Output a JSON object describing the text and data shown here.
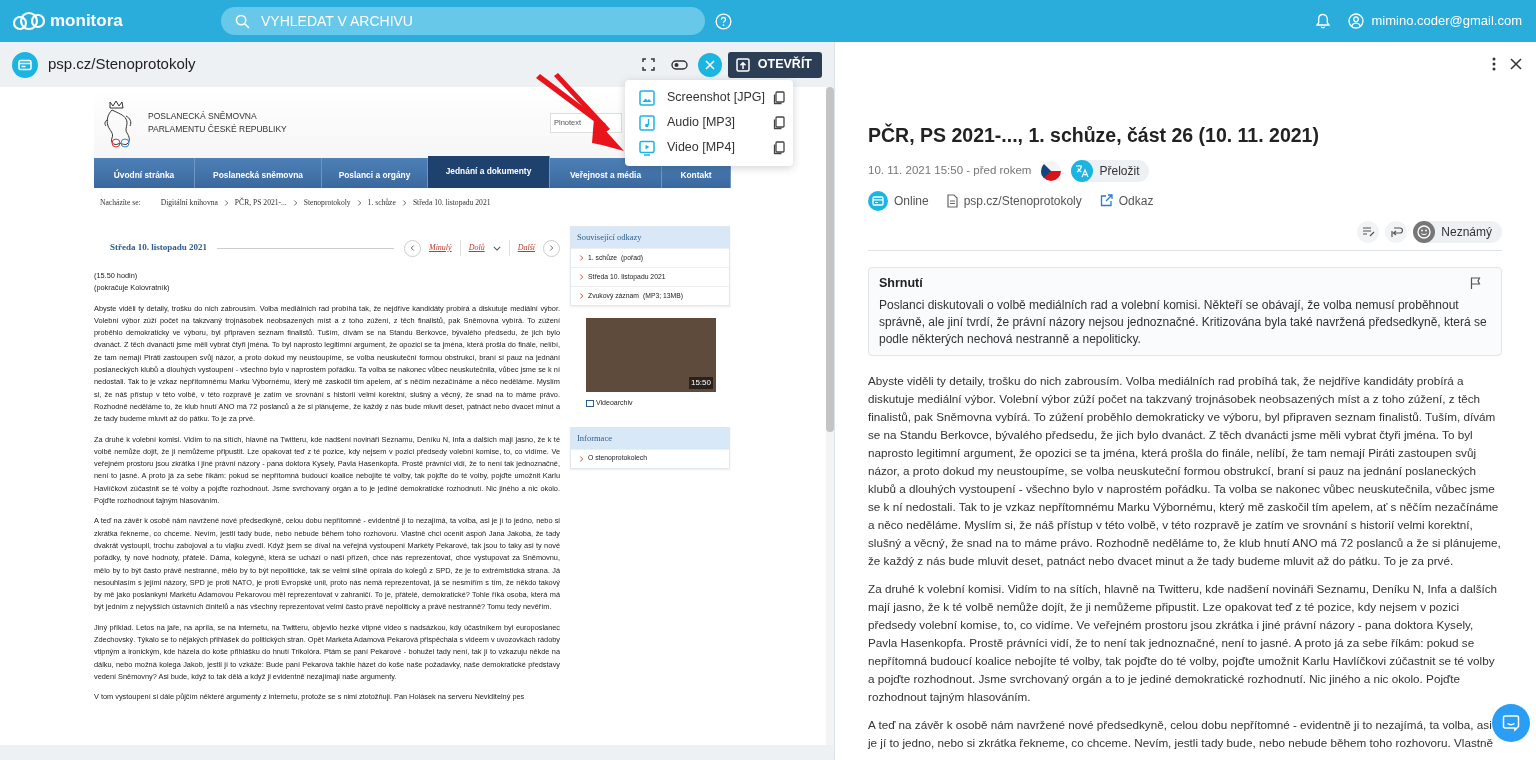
{
  "app_bar": {
    "logo": "monitora",
    "search_placeholder": "VYHLEDAT V ARCHIVU",
    "user": "mimino.coder@gmail.com"
  },
  "viewer": {
    "source": "psp.cz/Stenoprotokoly",
    "open_button": "OTEVŘÍT",
    "menu": [
      {
        "label": "Screenshot [JPG]",
        "kind": "image"
      },
      {
        "label": "Audio [MP3]",
        "kind": "audio"
      },
      {
        "label": "Video [MP4]",
        "kind": "video"
      }
    ]
  },
  "page": {
    "org_lines": [
      "POSLANECKÁ SNĚMOVNA",
      "PARLAMENTU ČESKÉ REPUBLIKY"
    ],
    "search_placeholder": "Plnotext",
    "nav": [
      {
        "label": "Úvodní stránka",
        "selected": false
      },
      {
        "label": "Poslanecká sněmovna",
        "selected": false
      },
      {
        "label": "Poslanci a orgány",
        "selected": false
      },
      {
        "label": "Jednání a dokumenty",
        "selected": true
      },
      {
        "label": "Veřejnost a média",
        "selected": false
      },
      {
        "label": "Kontakt",
        "selected": false
      }
    ],
    "breadcrumb_label": "Nacházíte se:",
    "breadcrumb": [
      "Digitální knihovna",
      "PČR, PS 2021-...",
      "Stenoprotokoly",
      "1. schůze",
      "Středa 10. listopadu 2021"
    ],
    "date_heading": "Středa 10. listopadu 2021",
    "pager": {
      "prev": "Minulý",
      "down": "Dolů",
      "next": "Další"
    },
    "intro_lines": [
      "(15.50 hodin)",
      "(pokračuje Kolovratník)"
    ],
    "paragraphs": [
      "Abyste viděli ty detaily, trošku do nich zabrousím. Volba mediálních rad probíhá tak, že nejdříve kandidáty probírá a diskutuje mediální výbor. Volební výbor zúží počet na takzvaný trojnásobek neobsazených míst a z toho zúžení, z těch finalistů, pak Sněmovna vybírá. To zúžení proběhlo demokraticky ve výboru, byl připraven seznam finalistů. Tuším, dívám se na Standu Berkovce, bývalého předsedu, že jich bylo dvanáct. Z těch dvanácti jsme měli vybrat čtyři jména. To byl naprosto legitimní argument, že opozici se ta jména, která prošla do finále, nelíbí, že tam nemají Piráti zastoupen svůj názor, a proto dokud my neustoupíme, se volba neuskuteční formou obstrukcí, braní si pauz na jednání poslaneckých klubů a dlouhých vystoupení - všechno bylo v naprostém pořádku. Ta volba se nakonec vůbec neuskutečnila, vůbec jsme se k ní nedostali. Tak to je vzkaz nepřítomnému Marku Výbornému, který mě zaskočil tím apelem, ať s něčím nezačínáme a něco neděláme. Myslím si, že náš přístup v této volbě, v této rozpravě je zatím ve srovnání s historií velmi korektní, slušný a věcný, že snad na to máme právo. Rozhodně neděláme to, že klub hnutí ANO má 72 poslanců a že si plánujeme, že každý z nás bude mluvit deset, patnáct nebo dvacet minut a že tady budeme mluvit až do pátku. To je za prvé.",
      "Za druhé k volební komisi. Vidím to na sítích, hlavně na Twitteru, kde nadšení novináři Seznamu, Deníku N, Infa a dalších mají jasno, že k té volbě nemůže dojít, že ji nemůžeme připustit. Lze opakovat teď z té pozice, kdy nejsem v pozici předsedy volební komise, to, co vidíme. Ve veřejném prostoru jsou zkrátka i jiné právní názory - pana doktora Kysely, Pavla Hasenkopfa. Prostě právníci vidí, že to není tak jednoznačné, není to jasné. A proto já za sebe říkám: pokud se nepřítomná budoucí koalice nebojíte té volby, tak pojďte do té volby, pojďte umožnit Karlu Havlíčkovi zúčastnit se té volby a pojďte rozhodnout. Jsme svrchovaný orgán a to je jediné demokratické rozhodnutí. Nic jiného a nic okolo. Pojďte rozhodnout tajným hlasováním.",
      "A teď na závěr k osobě nám navržené nové předsedkyně, celou dobu nepřítomné - evidentně ji to nezajímá, ta volba, asi je jí to jedno, nebo si zkrátka řekneme, co chceme. Nevím, jestli tady bude, nebo nebude během toho rozhovoru. Vlastně chci ocenit aspoň Jana Jakoba, že tady dvakrát vystoupil, trochu zabojoval a tu vlajku zvedl. Když jsem se díval na veřejná vystoupení Markéty Pekarové, tak jsou to taky asi ty nové pořádky, ty nové hodnoty, přátelé. Dáma, kolegyně, která se uchází o naši přízeň, chce nás reprezentovat, chce vystupovat za Sněmovnu, mělo by to být často právě nestranné, mělo by to být nepolitické, tak se velmi silně opírala do kolegů z SPD, že je to extrémistická strana. Já nesouhlasím s jejími názory, SPD je proti NATO, je proti Evropské unii, proto nás nemá reprezentovat, já se nesmířím s tím, že někdo takový by mě jako poslankyni Markétu Adamovou Pekarovou měl reprezentovat v zahraničí. To je, přátelé, demokratické? Tohle říká osoba, která má být jedním z nejvyšších ústavních činitelů a nás všechny reprezentovat velmi často právě nepoliticky a právě nestranně? Tomu tedy nevěřím.",
      "Jiný příklad. Letos na jaře, na apríla, se na internetu, na Twitteru, objevilo hezké vtipné video s nadsázkou, kdy účastníkem byl europoslanec Zdechovský. Týkalo se to nějakých přihlášek do politických stran. Opět Markéta Adamová Pekarová přispěchala s videem v uvozovkách rádoby vtipným a ironickým, kde házela do koše přihlášku do hnutí Trikolóra. Ptám se paní Pekarové - bohužel tady není, tak jí to vzkazuju někde na dálku, nebo možná kolega Jakob, jestli jí to vzkáže: Bude paní Pekarová takhle házet do koše naše požadavky, naše demokratické představy vedení Sněmovny? Asi bude, když to tak dělá a když ji evidentně nezajímají naše argumenty.",
      "V tom vystoupení si dále půjčím některé argumenty z internetu, protože se s nimi ztotožňuji. Pan Holásek na serveru Neviditelný pes"
    ],
    "related": {
      "title": "Související odkazy",
      "items": [
        {
          "link": "1. schůze",
          "note": "(pořad)"
        },
        {
          "link": "Středa 10. listopadu 2021"
        },
        {
          "link": "Zvukový záznam",
          "note": "(MP3; 13MB)"
        }
      ]
    },
    "video": {
      "time": "15:50",
      "link": "Videoarchiv"
    },
    "info": {
      "title": "Informace",
      "items": [
        {
          "link": "O stenoprotokolech"
        }
      ]
    }
  },
  "article": {
    "title": "PČR, PS 2021-..., 1. schůze, část 26 (10. 11. 2021)",
    "date": "10. 11. 2021 15:50 - před rokem",
    "translate": "Přeložit",
    "medium": "Online",
    "source": "psp.cz/Stenoprotokoly",
    "link": "Odkaz",
    "sentiment": "Neznámý",
    "summary": {
      "title": "Shrnutí",
      "text": "Poslanci diskutovali o volbě mediálních rad a volební komisi. Někteří se obávají, že volba nemusí proběhnout správně, ale jiní tvrdí, že právní názory nejsou jednoznačné. Kritizována byla také navržená předsedkyně, která se podle některých nechová nestranně a nepoliticky."
    },
    "paragraphs": [
      "Abyste viděli ty detaily, trošku do nich zabrousím. Volba mediálních rad probíhá tak, že nejdříve kandidáty probírá a diskutuje mediální výbor. Volební výbor zúží počet na takzvaný trojnásobek neobsazených míst a z toho zúžení, z těch finalistů, pak Sněmovna vybírá. To zúžení proběhlo demokraticky ve výboru, byl připraven seznam finalistů. Tuším, dívám se na Standu Berkovce, bývalého předsedu, že jich bylo dvanáct. Z těch dvanácti jsme měli vybrat čtyři jména. To byl naprosto legitimní argument, že opozici se ta jména, která prošla do finále, nelíbí, že tam nemají Piráti zastoupen svůj názor, a proto dokud my neustoupíme, se volba neuskuteční formou obstrukcí, braní si pauz na jednání poslaneckých klubů a dlouhých vystoupení - všechno bylo v naprostém pořádku. Ta volba se nakonec vůbec neuskutečnila, vůbec jsme se k ní nedostali. Tak to je vzkaz nepřítomnému Marku Výbornému, který mě zaskočil tím apelem, ať s něčím nezačínáme a něco neděláme. Myslím si, že náš přístup v této volbě, v této rozpravě je zatím ve srovnání s historií velmi korektní, slušný a věcný, že snad na to máme právo. Rozhodně neděláme to, že klub hnutí ANO má 72 poslanců a že si plánujeme, že každý z nás bude mluvit deset, patnáct nebo dvacet minut a že tady budeme mluvit až do pátku. To je za prvé.",
      "Za druhé k volební komisi. Vidím to na sítích, hlavně na Twitteru, kde nadšení novináři Seznamu, Deníku N, Infa a dalších mají jasno, že k té volbě nemůže dojít, že ji nemůžeme připustit. Lze opakovat teď z té pozice, kdy nejsem v pozici předsedy volební komise, to, co vidíme. Ve veřejném prostoru jsou zkrátka i jiné právní názory - pana doktora Kysely, Pavla Hasenkopfa. Prostě právníci vidí, že to není tak jednoznačné, není to jasné. A proto já za sebe říkám: pokud se nepřítomná budoucí koalice nebojíte té volby, tak pojďte do té volby, pojďte umožnit Karlu Havlíčkovi zúčastnit se té volby a pojďte rozhodnout. Jsme svrchovaný orgán a to je jediné demokratické rozhodnutí. Nic jiného a nic okolo. Pojďte rozhodnout tajným hlasováním.",
      "A teď na závěr k osobě nám navržené nové předsedkyně, celou dobu nepřítomné - evidentně ji to nezajímá, ta volba, asi je jí to jedno, nebo si zkrátka řekneme, co chceme. Nevím, jestli tady bude, nebo nebude během toho rozhovoru. Vlastně"
    ]
  }
}
